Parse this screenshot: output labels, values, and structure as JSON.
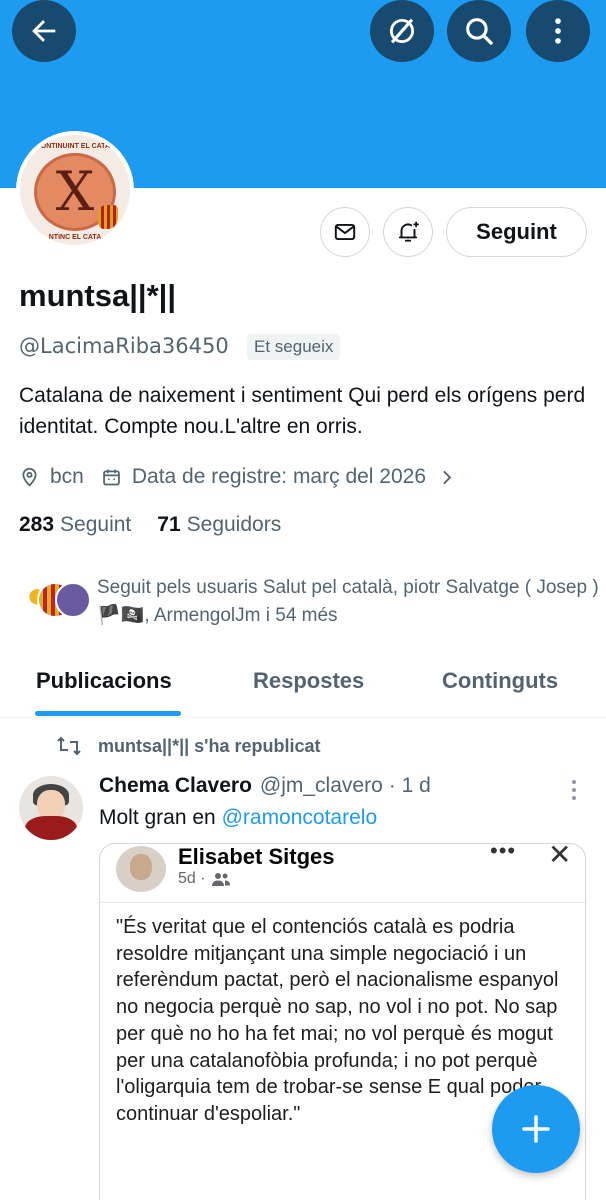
{
  "profile": {
    "avatar_caption_top": "CONTINUINT EL CATAL",
    "avatar_caption_bottom": "NTINC EL CATA",
    "avatar_glyph": "X",
    "name": "muntsa||*||",
    "handle": "@LacimaRiba36450",
    "follows_you": "Et segueix",
    "bio": "Catalana de naixement i sentiment Qui perd els orígens perd identitat. Compte nou.L'altre en orris.",
    "location": "bcn",
    "joined": "Data de registre: març del 2026",
    "following_count": "283",
    "following_label": "Seguint",
    "followers_count": "71",
    "followers_label": "Seguidors",
    "followed_by": "Seguit pels usuaris Salut pel català, piotr Salvatge ( Josep )🏴🏴‍☠️, ArmengolJm i 54 més"
  },
  "actions": {
    "follow_label": "Seguint"
  },
  "tabs": [
    {
      "label": "Publicacions",
      "active": true
    },
    {
      "label": "Respostes",
      "active": false
    },
    {
      "label": "Continguts",
      "active": false
    }
  ],
  "post": {
    "repost_label": "muntsa||*|| s'ha republicat",
    "author": "Chema Clavero",
    "author_handle": "@jm_clavero",
    "time": "· 1 d",
    "text": "Molt gran en",
    "mention": "@ramoncotarelo",
    "media": {
      "name": "Elisabet Sitges",
      "sub": "5d ·",
      "dots": "•••",
      "close": "✕",
      "quote": "\"És veritat que el contenciós català es podria resoldre mitjançant una simple negociació i un referèndum pactat, però el nacionalisme espanyol no negocia perquè no sap, no vol i no pot. No sap per què no ho ha fet mai; no vol perquè és mogut per una catalanofòbia profunda; i no pot perquè l'oligarquia tem de trobar-se sense E qual poder continuar d'espoliar.\""
    }
  },
  "colors": {
    "accent": "#1d9bf0",
    "banner": "#1d9bf0",
    "top_button": "#174a6e"
  },
  "icons": [
    "back-arrow-icon",
    "grok-icon",
    "search-icon",
    "more-vertical-icon",
    "mail-icon",
    "bell-plus-icon",
    "location-icon",
    "calendar-icon",
    "chevron-right-icon",
    "repost-icon",
    "plus-icon"
  ]
}
